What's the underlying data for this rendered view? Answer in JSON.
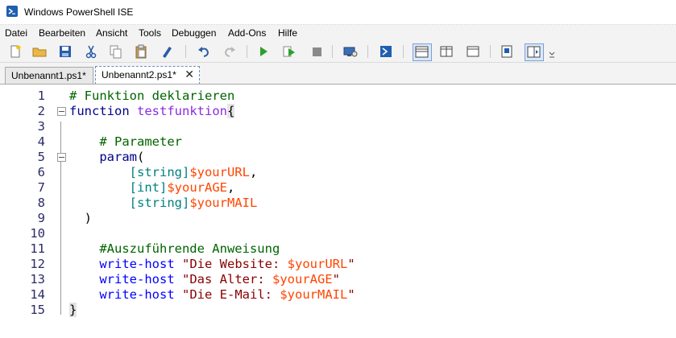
{
  "window": {
    "title": "Windows PowerShell ISE"
  },
  "menu": [
    "Datei",
    "Bearbeiten",
    "Ansicht",
    "Tools",
    "Debuggen",
    "Add-Ons",
    "Hilfe"
  ],
  "toolbar": {
    "icons": [
      "new-file-icon",
      "open-folder-icon",
      "save-icon",
      "cut-icon",
      "copy-icon",
      "paste-icon",
      "clear-console-icon",
      "undo-icon",
      "redo-icon",
      "run-script-icon",
      "run-selection-icon",
      "stop-icon",
      "remote-powershell-icon",
      "powershell-console-icon",
      "show-script-pane-top-icon",
      "show-script-pane-right-icon",
      "show-script-pane-maximized-icon",
      "show-command-pane-icon",
      "show-command-addon-icon",
      "toolbar-overflow-icon"
    ]
  },
  "tabs": [
    {
      "label": "Unbenannt1.ps1*",
      "active": false
    },
    {
      "label": "Unbenannt2.ps1*",
      "active": true,
      "close": "✕"
    }
  ],
  "editor": {
    "lines": [
      {
        "num": "1",
        "tokens": [
          {
            "t": "# Funktion deklarieren",
            "c": "c-comment"
          }
        ]
      },
      {
        "num": "2",
        "fold": true,
        "tokens": [
          {
            "t": "function",
            "c": "c-kw"
          },
          {
            "t": " ",
            "c": "c-punct"
          },
          {
            "t": "testfunktion",
            "c": "c-fn"
          },
          {
            "t": "{",
            "c": "c-punct brace-hl"
          }
        ]
      },
      {
        "num": "3",
        "tokens": []
      },
      {
        "num": "4",
        "tokens": [
          {
            "t": "    # Parameter",
            "c": "c-comment"
          }
        ]
      },
      {
        "num": "5",
        "fold": true,
        "tokens": [
          {
            "t": "    param",
            "c": "c-kw"
          },
          {
            "t": "(",
            "c": "c-punct"
          }
        ]
      },
      {
        "num": "6",
        "tokens": [
          {
            "t": "        ",
            "c": "c-punct"
          },
          {
            "t": "[string]",
            "c": "c-type"
          },
          {
            "t": "$yourURL",
            "c": "c-var"
          },
          {
            "t": ",",
            "c": "c-punct"
          }
        ]
      },
      {
        "num": "7",
        "tokens": [
          {
            "t": "        ",
            "c": "c-punct"
          },
          {
            "t": "[int]",
            "c": "c-type"
          },
          {
            "t": "$yourAGE",
            "c": "c-var"
          },
          {
            "t": ",",
            "c": "c-punct"
          }
        ]
      },
      {
        "num": "8",
        "tokens": [
          {
            "t": "        ",
            "c": "c-punct"
          },
          {
            "t": "[string]",
            "c": "c-type"
          },
          {
            "t": "$yourMAIL",
            "c": "c-var"
          }
        ]
      },
      {
        "num": "9",
        "tokens": [
          {
            "t": "  )",
            "c": "c-punct"
          }
        ]
      },
      {
        "num": "10",
        "tokens": []
      },
      {
        "num": "11",
        "tokens": [
          {
            "t": "    #Auszuführende Anweisung",
            "c": "c-comment"
          }
        ]
      },
      {
        "num": "12",
        "tokens": [
          {
            "t": "    write-host",
            "c": "c-cmd"
          },
          {
            "t": " ",
            "c": "c-punct"
          },
          {
            "t": "\"Die Website: ",
            "c": "c-str"
          },
          {
            "t": "$yourURL",
            "c": "c-var"
          },
          {
            "t": "\"",
            "c": "c-str"
          }
        ]
      },
      {
        "num": "13",
        "tokens": [
          {
            "t": "    write-host",
            "c": "c-cmd"
          },
          {
            "t": " ",
            "c": "c-punct"
          },
          {
            "t": "\"Das Alter: ",
            "c": "c-str"
          },
          {
            "t": "$yourAGE",
            "c": "c-var"
          },
          {
            "t": "\"",
            "c": "c-str"
          }
        ]
      },
      {
        "num": "14",
        "tokens": [
          {
            "t": "    write-host",
            "c": "c-cmd"
          },
          {
            "t": " ",
            "c": "c-punct"
          },
          {
            "t": "\"Die E-Mail: ",
            "c": "c-str"
          },
          {
            "t": "$yourMAIL",
            "c": "c-var"
          },
          {
            "t": "\"",
            "c": "c-str"
          }
        ]
      },
      {
        "num": "15",
        "tokens": [
          {
            "t": "}",
            "c": "c-punct brace-hl"
          }
        ]
      }
    ]
  }
}
